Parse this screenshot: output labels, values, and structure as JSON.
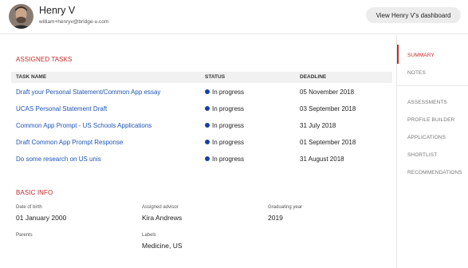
{
  "user": {
    "name": "Henry V",
    "email": "william+henryv@bridge-u.com"
  },
  "header": {
    "dashboard_button": "View Henry V's dashboard"
  },
  "tasks": {
    "title": "ASSIGNED TASKS",
    "columns": [
      "TASK NAME",
      "STATUS",
      "DEADLINE"
    ],
    "rows": [
      {
        "name": "Draft your Personal Statement/Common App essay",
        "status": "In progress",
        "deadline": "05 November 2018"
      },
      {
        "name": "UCAS Personal Statement Draft",
        "status": "In progress",
        "deadline": "03 September 2018"
      },
      {
        "name": "Common App Prompt - US Schools Applications",
        "status": "In progress",
        "deadline": "31 July 2018"
      },
      {
        "name": "Draft Common App Prompt Response",
        "status": "In progress",
        "deadline": "01 September 2018"
      },
      {
        "name": "Do some research on US unis",
        "status": "In progress",
        "deadline": "31 August 2018"
      }
    ]
  },
  "basic_info": {
    "title": "BASIC INFO",
    "dob_label": "Date of birth",
    "dob_value": "01 January 2000",
    "advisor_label": "Assigned advisor",
    "advisor_value": "Kira Andrews",
    "grad_label": "Graduating year",
    "grad_value": "2019",
    "parents_label": "Parents",
    "labels_label": "Labels",
    "labels_value": "Medicine, US"
  },
  "sidebar": {
    "items": [
      "SUMMARY",
      "NOTES",
      "ASSESSMENTS",
      "PROFILE BUILDER",
      "APPLICATIONS",
      "SHORTLIST",
      "RECOMMENDATIONS"
    ],
    "active": "SUMMARY"
  },
  "colors": {
    "accent": "#c62828",
    "link": "#1f56b5",
    "status_dot": "#1b3f9e"
  }
}
